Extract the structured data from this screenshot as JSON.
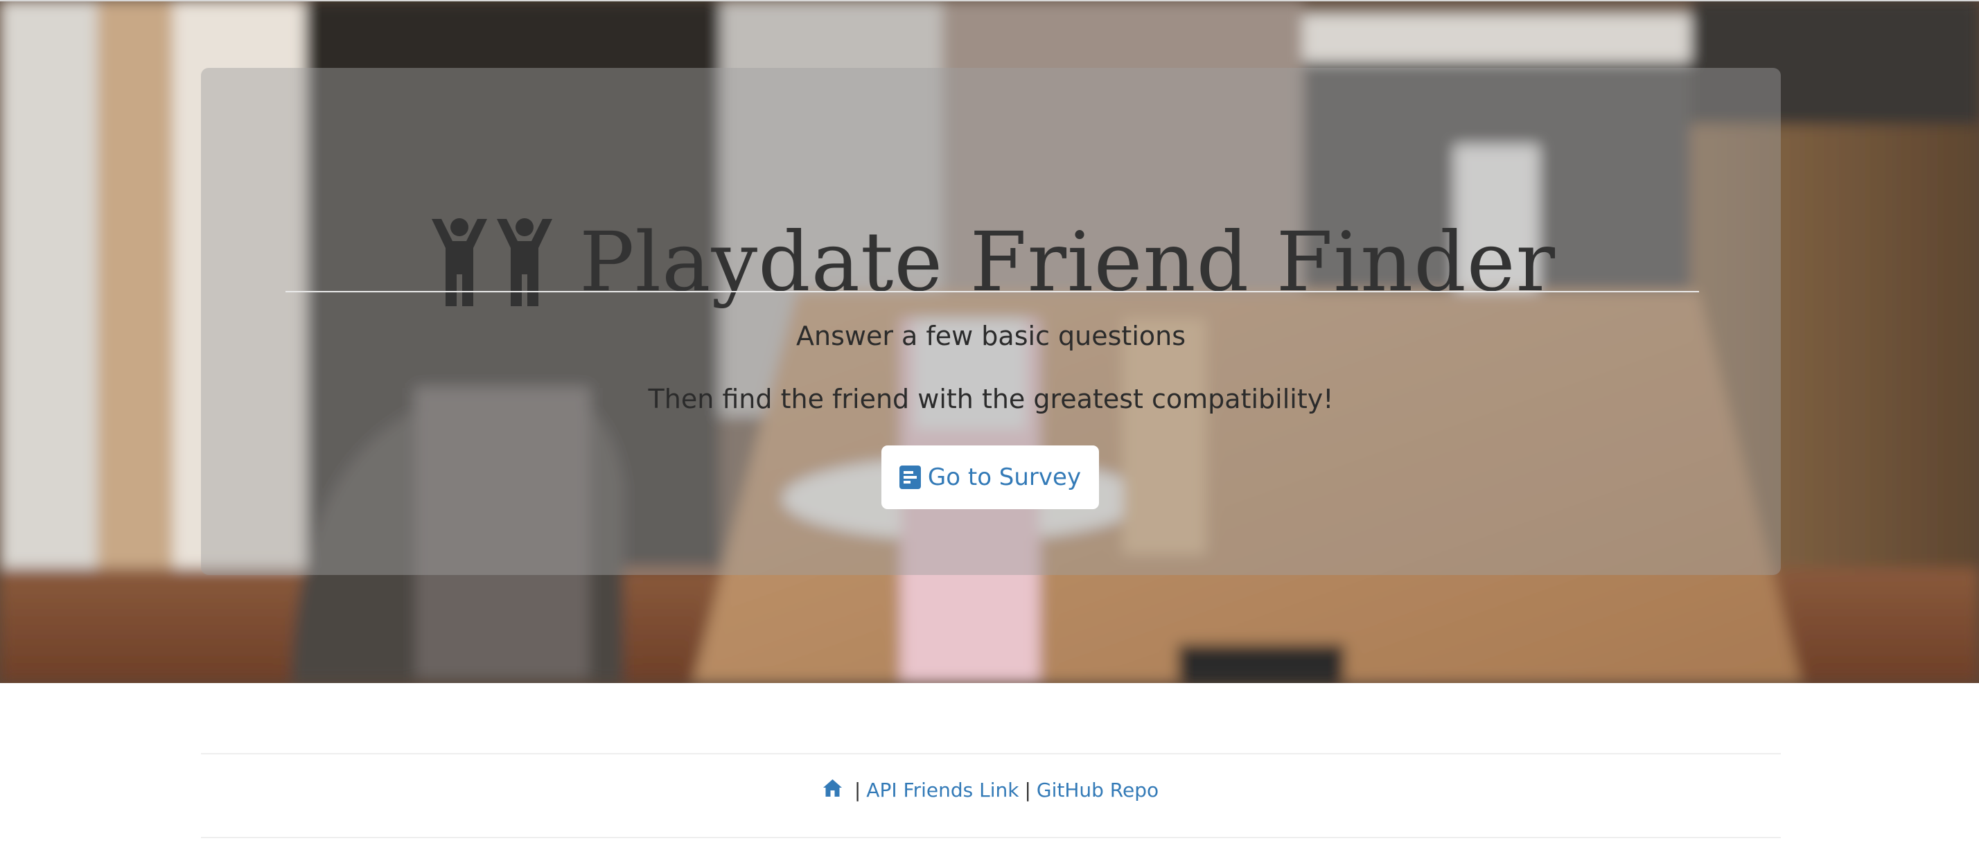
{
  "hero": {
    "title": "Playdate Friend Finder",
    "title_icon": "kids-icon",
    "lead_line_1": "Answer a few basic questions",
    "lead_line_2": "Then find the friend with the greatest compatibility!",
    "survey_button": {
      "label": "Go to Survey",
      "icon": "clipboard-icon"
    },
    "background": "kitchen table photo"
  },
  "footer": {
    "home_icon": "home-icon",
    "separator": "|",
    "links": [
      {
        "label": "API Friends Link"
      },
      {
        "label": "GitHub Repo"
      }
    ]
  },
  "colors": {
    "link": "#337ab7",
    "title": "#333333",
    "jumbotron_overlay": "rgba(160,160,160,0.45)"
  }
}
